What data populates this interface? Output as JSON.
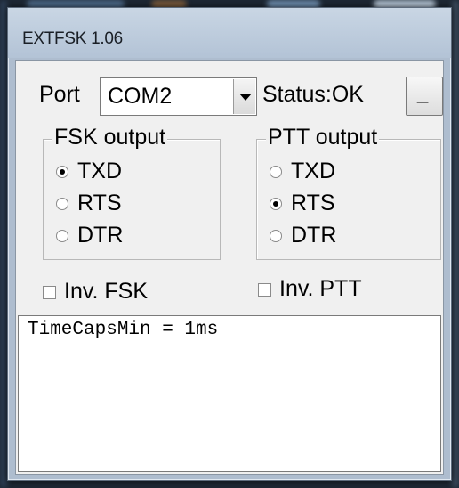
{
  "window": {
    "title": "EXTFSK 1.06"
  },
  "port": {
    "label": "Port",
    "selected": "COM2",
    "dropdown_icon": "chevron-down-icon"
  },
  "status": {
    "text": "Status:OK"
  },
  "minimize_button": {
    "label": "_"
  },
  "fsk_output": {
    "title": "FSK output",
    "options": [
      {
        "label": "TXD",
        "checked": true
      },
      {
        "label": "RTS",
        "checked": false
      },
      {
        "label": "DTR",
        "checked": false
      }
    ],
    "invert_label": "Inv. FSK",
    "invert_checked": false
  },
  "ptt_output": {
    "title": "PTT output",
    "options": [
      {
        "label": "TXD",
        "checked": false
      },
      {
        "label": "RTS",
        "checked": true
      },
      {
        "label": "DTR",
        "checked": false
      }
    ],
    "invert_label": "Inv. PTT",
    "invert_checked": false
  },
  "log": {
    "text": "TimeCapsMin = 1ms"
  }
}
